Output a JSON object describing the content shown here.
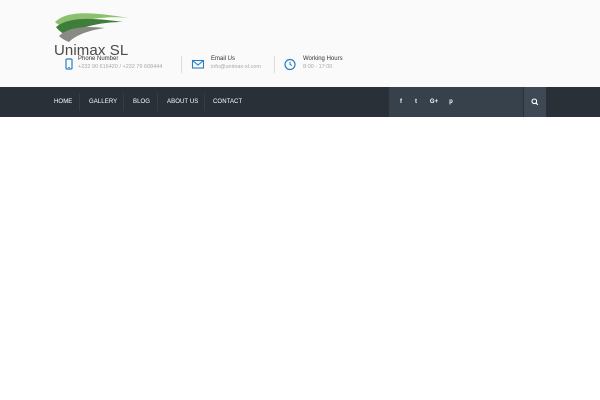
{
  "brand": {
    "name": "Unimax SL",
    "colors": {
      "leaf_dark": "#3f7d3a",
      "leaf_light": "#8cbf6e",
      "leaf_grey": "#8a8a84"
    }
  },
  "contact": {
    "phone": {
      "icon": "phone-icon",
      "title": "Phone Number",
      "value": "+232 90 616420 / +232 79 608444"
    },
    "email": {
      "icon": "envelope-icon",
      "title": "Email Us",
      "value": "info@unimax-sl.com"
    },
    "hours": {
      "icon": "clock-icon",
      "title": "Working Hours",
      "value": "8:00 - 17:00"
    }
  },
  "nav": {
    "items": [
      {
        "label": "HOME"
      },
      {
        "label": "GALLERY"
      },
      {
        "label": "BLOG"
      },
      {
        "label": "ABOUT US"
      },
      {
        "label": "CONTACT"
      }
    ]
  },
  "social": {
    "items": [
      {
        "icon": "facebook-icon",
        "glyph": "f"
      },
      {
        "icon": "twitter-icon",
        "glyph": "t"
      },
      {
        "icon": "google-plus-icon",
        "glyph": "G+"
      },
      {
        "icon": "pinterest-icon",
        "glyph": "p"
      }
    ],
    "search_icon": "search-icon"
  },
  "theme": {
    "navbar_bg": "#2a3037",
    "social_bg": "#36414c",
    "accent_blue": "#2a7fc0"
  }
}
